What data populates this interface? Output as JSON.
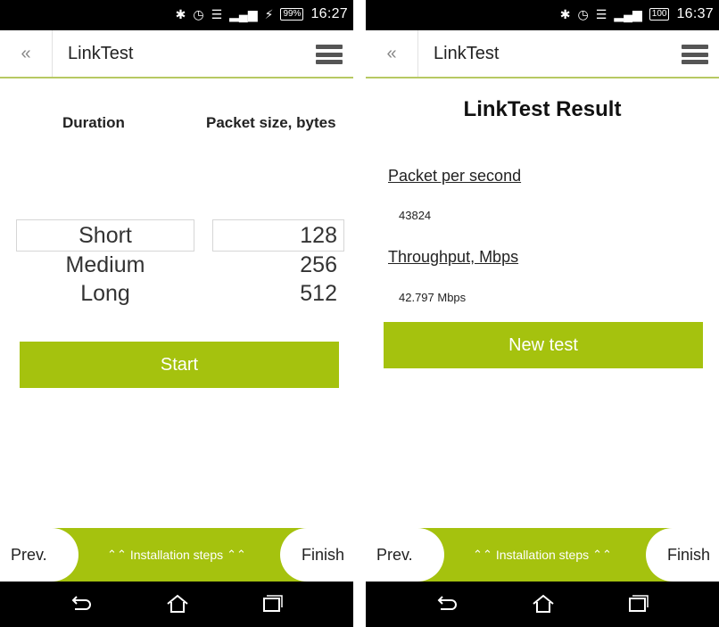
{
  "status": {
    "left_time": "16:27",
    "left_battery": "99%",
    "right_time": "16:37",
    "right_battery": "100"
  },
  "header": {
    "back_symbol": "«",
    "title": "LinkTest",
    "menu_icon": "hamburger-icon"
  },
  "setup": {
    "duration_label": "Duration",
    "packet_label": "Packet size, bytes",
    "durations": [
      "Short",
      "Medium",
      "Long"
    ],
    "packet_sizes": [
      "128",
      "256",
      "512"
    ],
    "selected_duration": "Short",
    "selected_packet": "128",
    "start_label": "Start"
  },
  "result": {
    "title": "LinkTest Result",
    "pps_label": "Packet per second",
    "pps_value": "43824",
    "throughput_label": "Throughput, Mbps",
    "throughput_value": "42.797 Mbps",
    "new_test_label": "New test"
  },
  "footer": {
    "prev_label": "Prev.",
    "steps_label": "Installation steps",
    "finish_label": "Finish"
  },
  "colors": {
    "accent": "#a5c20e",
    "header_line": "#b7c962"
  }
}
